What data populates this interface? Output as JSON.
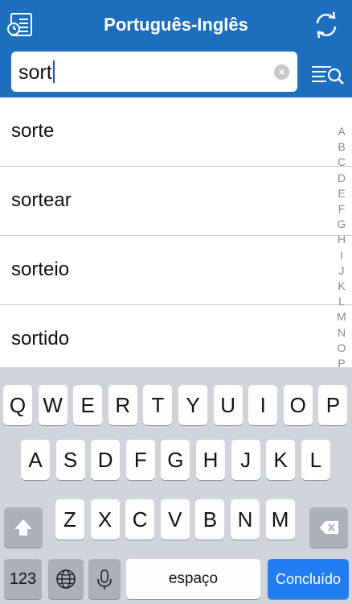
{
  "header": {
    "title": "Português-Inglês",
    "left_icon": "history-list-icon",
    "right_icon": "swap-direction-icon"
  },
  "search": {
    "value": "sort",
    "clear_icon": "clear-icon",
    "list_search_icon": "list-search-icon"
  },
  "results": [
    {
      "label": "sorte"
    },
    {
      "label": "sortear"
    },
    {
      "label": "sorteio"
    },
    {
      "label": "sortido"
    }
  ],
  "index_letters": [
    "A",
    "B",
    "C",
    "D",
    "E",
    "F",
    "G",
    "H",
    "I",
    "J",
    "K",
    "L",
    "M",
    "N",
    "O",
    "P"
  ],
  "keyboard": {
    "row1": [
      "Q",
      "W",
      "E",
      "R",
      "T",
      "Y",
      "U",
      "I",
      "O",
      "P"
    ],
    "row2": [
      "A",
      "S",
      "D",
      "F",
      "G",
      "H",
      "J",
      "K",
      "L"
    ],
    "row3": [
      "Z",
      "X",
      "C",
      "V",
      "B",
      "N",
      "M"
    ],
    "numbers_label": "123",
    "space_label": "espaço",
    "done_label": "Concluído",
    "shift_icon": "shift-icon",
    "delete_icon": "delete-icon",
    "globe_icon": "globe-icon",
    "mic_icon": "microphone-icon"
  },
  "colors": {
    "header": "#1d6fbd",
    "done": "#1f7cf1",
    "keyboard_bg": "#d1d5db"
  }
}
